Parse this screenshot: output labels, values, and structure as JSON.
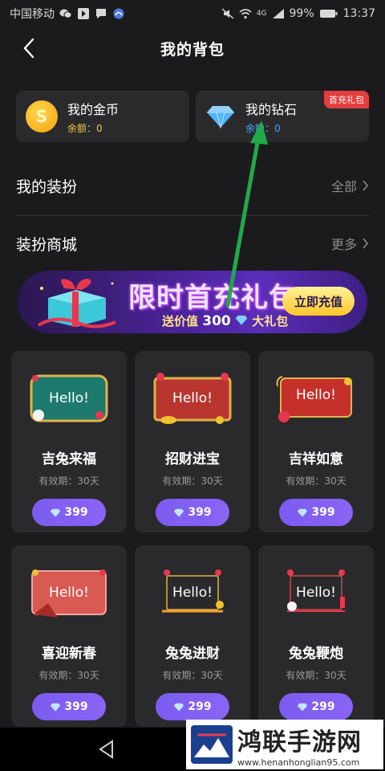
{
  "status_bar": {
    "carrier": "中国移动",
    "network": "4G",
    "battery": "99%",
    "time": "13:37"
  },
  "header": {
    "title": "我的背包"
  },
  "balances": {
    "coins": {
      "title": "我的金币",
      "label": "余额：",
      "value": "0"
    },
    "diamonds": {
      "title": "我的钻石",
      "label": "余额：",
      "value": "0",
      "badge": "首充礼包"
    }
  },
  "menu": {
    "outfits": {
      "label": "我的装扮",
      "link": "全部"
    },
    "shop": {
      "label": "装扮商城",
      "link": "更多"
    }
  },
  "banner": {
    "title": "限时首充礼包",
    "sub_prefix": "送价值",
    "sub_amount": "300",
    "sub_suffix": "大礼包",
    "button": "立即充值"
  },
  "items": [
    {
      "frame_text": "Hello!",
      "name": "吉兔来福",
      "valid": "有效期：30天",
      "price": "399"
    },
    {
      "frame_text": "Hello!",
      "name": "招财进宝",
      "valid": "有效期：30天",
      "price": "399"
    },
    {
      "frame_text": "Hello!",
      "name": "吉祥如意",
      "valid": "有效期：30天",
      "price": "399"
    },
    {
      "frame_text": "Hello!",
      "name": "喜迎新春",
      "valid": "有效期：30天",
      "price": "399"
    },
    {
      "frame_text": "Hello!",
      "name": "兔兔进财",
      "valid": "有效期：30天",
      "price": "299"
    },
    {
      "frame_text": "Hello!",
      "name": "兔兔鞭炮",
      "valid": "有效期：30天",
      "price": "299"
    }
  ],
  "watermark": {
    "title": "鸿联手游网",
    "url": "www.henanhonglian95.com"
  },
  "colors": {
    "background": "#1b1b1d",
    "card": "#2a2a2c",
    "price_button": "#7b5cf0",
    "gold": "#e7c44b",
    "blue": "#4aa3ff",
    "badge": "#e43d3d"
  }
}
